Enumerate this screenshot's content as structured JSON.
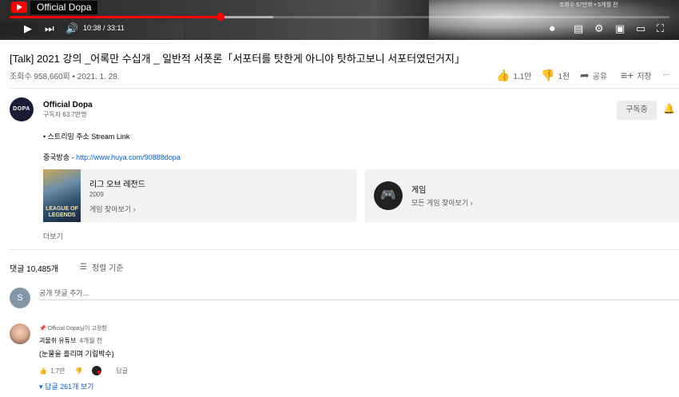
{
  "player": {
    "channel_watermark": "Official Dopa",
    "overlay_stats": "조회수 67만회 • 5개월 전",
    "current_time": "10:38",
    "duration": "33:11",
    "progress_fraction": 0.32,
    "buffer_fraction": 0.4,
    "accent_color": "#ff0000"
  },
  "video": {
    "title": "[Talk] 2021 강의 _어록만 수십개 _ 일반적 서폿론「서포터를 탓한게 아니야 탓하고보니 서포터였던거지」",
    "views": "조회수 958,660회",
    "date": "2021. 1. 28.",
    "likes": "1.1만",
    "dislikes": "1천",
    "share_label": "공유",
    "save_label": "저장",
    "more_label": "..."
  },
  "channel": {
    "avatar_text": "DOPA",
    "name": "Official Dopa",
    "subscribers": "구독자 63.7만명",
    "subscribe_label": "구독중"
  },
  "description": {
    "line1": "• 스트리밍 주소 Stream Link",
    "line2_prefix": "중국방송 - ",
    "line2_link": "http://www.huya.com/90888dopa"
  },
  "game_card": {
    "art_text": "LEAGUE OF LEGENDS",
    "title": "리그 오브 레전드",
    "year": "2009",
    "link": "게임 찾아보기"
  },
  "category_card": {
    "title": "게임",
    "link": "모든 게임 찾아보기"
  },
  "show_more": "더보기",
  "comments": {
    "count": "댓글 10,485개",
    "sort_label": "정렬 기준",
    "input_avatar": "S",
    "input_placeholder": "공개 댓글 추가...",
    "items": [
      {
        "pinned": "Official Dopa님이 고정함",
        "author": "괴물쥐 유튜브",
        "time": "4개월 전",
        "text": "(눈물을 흘리며 기립박수)",
        "likes": "1.7만",
        "reply_label": "답글",
        "replies": "답글 261개 보기"
      }
    ]
  }
}
